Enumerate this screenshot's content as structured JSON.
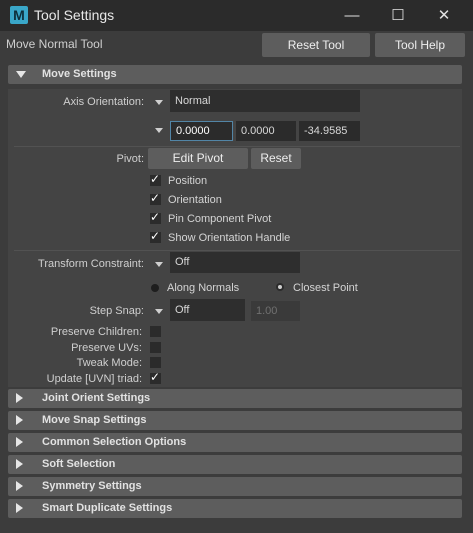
{
  "window": {
    "title": "Tool Settings",
    "icon": "maya-app-icon",
    "controls": [
      "minimize",
      "maximize",
      "close"
    ]
  },
  "header": {
    "tool_name": "Move Normal Tool",
    "reset_label": "Reset Tool",
    "help_label": "Tool Help"
  },
  "move_settings": {
    "title": "Move Settings",
    "axis_orientation_label": "Axis Orientation:",
    "axis_orientation_value": "Normal",
    "vector": [
      "0.0000",
      "0.0000",
      "-34.9585"
    ],
    "pivot_label": "Pivot:",
    "edit_pivot_label": "Edit Pivot",
    "reset_label": "Reset",
    "pivot_options": [
      {
        "label": "Position",
        "checked": true
      },
      {
        "label": "Orientation",
        "checked": true
      },
      {
        "label": "Pin Component Pivot",
        "checked": true
      },
      {
        "label": "Show Orientation Handle",
        "checked": true
      }
    ],
    "transform_constraint_label": "Transform Constraint:",
    "transform_constraint_value": "Off",
    "along_normals_label": "Along Normals",
    "closest_point_label": "Closest Point",
    "selected_radio": "closest_point",
    "step_snap_label": "Step Snap:",
    "step_snap_value": "Off",
    "step_snap_amount": "1.00",
    "preserve_children_label": "Preserve Children:",
    "preserve_uvs_label": "Preserve UVs:",
    "tweak_mode_label": "Tweak Mode:",
    "update_uvn_label": "Update [UVN] triad:",
    "preserve_children": false,
    "preserve_uvs": false,
    "tweak_mode": false,
    "update_uvn": true
  },
  "collapsed_sections": [
    "Joint Orient Settings",
    "Move Snap Settings",
    "Common Selection Options",
    "Soft Selection",
    "Symmetry Settings",
    "Smart Duplicate Settings"
  ],
  "colors": {
    "background": "#3c3c3c",
    "titlebar": "#2b2b2b",
    "frame_header": "#5d5d5d",
    "field": "#2b2b2b",
    "focus": "#5285a6",
    "brand": "#3aa7c9"
  }
}
